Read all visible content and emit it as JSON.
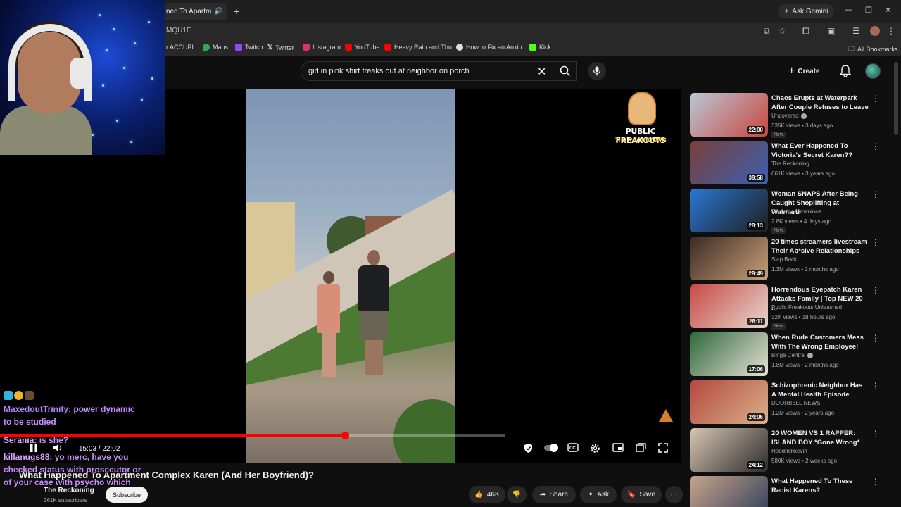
{
  "browser": {
    "tab_title": "ned To Apartm",
    "url_fragment": "MQU1E",
    "gemini_label": "Ask Gemini",
    "all_bookmarks_label": "All Bookmarks",
    "bookmarks": [
      {
        "label": "r ACCUPL...",
        "icon": "bookmark-icon",
        "color": "#5f6368"
      },
      {
        "label": "Maps",
        "icon": "maps-icon",
        "color": "#34a853"
      },
      {
        "label": "Twitch",
        "icon": "twitch-icon",
        "color": "#9146ff"
      },
      {
        "label": "Twitter",
        "icon": "x-icon",
        "color": "#ffffff"
      },
      {
        "label": "Instagram",
        "icon": "instagram-icon",
        "color": "#e1306c"
      },
      {
        "label": "YouTube",
        "icon": "youtube-icon",
        "color": "#ff0000"
      },
      {
        "label": "Heavy Rain and Thu...",
        "icon": "youtube-icon",
        "color": "#ff0000"
      },
      {
        "label": "How to Fix an Anxio...",
        "icon": "globe-icon",
        "color": "#dddddd"
      },
      {
        "label": "Kick",
        "icon": "kick-icon",
        "color": "#53fc18"
      }
    ]
  },
  "header": {
    "search_query": "girl in pink shirt freaks out at neighbor on porch",
    "create_label": "Create"
  },
  "player": {
    "channel_badge_title": "PUBLIC FREAKOUTS",
    "channel_badge_subtitle": "The RECKONING",
    "time_display": "15:03 / 22:02",
    "progress_fraction": 0.683,
    "buffered_fraction": 1.0,
    "accent": "#ff0000"
  },
  "video": {
    "title": "What Happened To Apartment Complex Karen (And Her Boyfriend)?",
    "channel": "The Reckoning",
    "subscribers": "261K subscribers",
    "subscribe_label": "Subscribe",
    "likes": "46K",
    "share_label": "Share",
    "ask_label": "Ask",
    "save_label": "Save"
  },
  "chat": {
    "messages": [
      {
        "user": "MaxedoutTrinity:",
        "text": "power dynamic to be studied"
      },
      {
        "user": "Serania:",
        "text": "is she?"
      },
      {
        "user": "killanugs88:",
        "text": "yo merc, have you checked status with prosecutor or of your case with psycho which"
      }
    ]
  },
  "recommendations": [
    {
      "title": "Chaos Erupts at Waterpark After Couple Refuses to Leave",
      "channel": "Uncovered",
      "verified": true,
      "meta": "335K views • 3 days ago",
      "badge": "New",
      "duration": "22:00",
      "thumb_a": "#b9c8d6",
      "thumb_b": "#c9463f"
    },
    {
      "title": "What Ever Happened To Victoria's Secret Karen??",
      "channel": "The Reckoning",
      "verified": false,
      "meta": "661K views • 3 years ago",
      "badge": "",
      "duration": "39:58",
      "thumb_a": "#7a3f3a",
      "thumb_b": "#3b5fb0"
    },
    {
      "title": "Woman SNAPS After Being Caught Shoplifting at Walmart!",
      "channel": "Secretos femeninos",
      "verified": false,
      "meta": "2.8K views • 4 days ago",
      "badge": "New",
      "duration": "28:13",
      "thumb_a": "#2a78d6",
      "thumb_b": "#1e1e1e"
    },
    {
      "title": "20 times streamers livestream Their Ab*sive Relationships",
      "channel": "Slap Back",
      "verified": false,
      "meta": "1.3M views • 2 months ago",
      "badge": "",
      "duration": "29:49",
      "thumb_a": "#3a2a22",
      "thumb_b": "#c9a07a"
    },
    {
      "title": "Horrendous Eyepatch Karen Attacks Family | Top NEW 20 ...",
      "channel": "Public Freakouts Unleashed",
      "verified": false,
      "meta": "32K views • 18 hours ago",
      "badge": "New",
      "duration": "28:11",
      "thumb_a": "#c74a44",
      "thumb_b": "#e8d6cf"
    },
    {
      "title": "When Rude Customers Mess With The Wrong Employee!",
      "channel": "Binge Central",
      "verified": true,
      "meta": "1.8M views • 2 months ago",
      "badge": "",
      "duration": "17:06",
      "thumb_a": "#2f6a3a",
      "thumb_b": "#e7e0d6"
    },
    {
      "title": "Schizophrenic Neighbor Has A Mental Health Episode",
      "channel": "DOORBELL NEWS",
      "verified": false,
      "meta": "1.2M views • 2 years ago",
      "badge": "",
      "duration": "24:06",
      "thumb_a": "#b5483f",
      "thumb_b": "#d8b08a"
    },
    {
      "title": "20 WOMEN VS 1 RAPPER: ISLAND BOY *Gone Wrong*",
      "channel": "Hoodrichkevin",
      "verified": false,
      "meta": "580K views • 2 weeks ago",
      "badge": "",
      "duration": "24:12",
      "thumb_a": "#d7c6b4",
      "thumb_b": "#2c2c2c"
    },
    {
      "title": "What Happened To These Racist Karens?",
      "channel": "",
      "verified": false,
      "meta": "",
      "badge": "",
      "duration": "",
      "thumb_a": "#c9a48a",
      "thumb_b": "#2e3d5a"
    }
  ]
}
